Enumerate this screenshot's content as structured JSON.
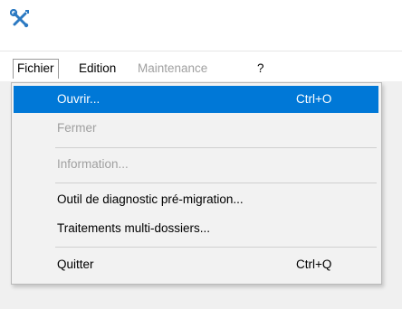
{
  "titlebar": {
    "icon": "tools-icon",
    "icon_color": "#2b79c2"
  },
  "menubar": {
    "items": [
      {
        "label": "Fichier",
        "state": "active"
      },
      {
        "label": "Edition",
        "state": "enabled"
      },
      {
        "label": "Maintenance",
        "state": "disabled"
      },
      {
        "label": "?",
        "state": "enabled"
      }
    ]
  },
  "file_menu": {
    "items": [
      {
        "label": "Ouvrir...",
        "shortcut": "Ctrl+O",
        "state": "highlighted"
      },
      {
        "label": "Fermer",
        "shortcut": "",
        "state": "disabled"
      },
      {
        "label": "Information...",
        "shortcut": "",
        "state": "disabled"
      },
      {
        "label": "Outil de diagnostic pré-migration...",
        "shortcut": "",
        "state": "enabled"
      },
      {
        "label": "Traitements multi-dossiers...",
        "shortcut": "",
        "state": "enabled"
      },
      {
        "label": "Quitter",
        "shortcut": "Ctrl+Q",
        "state": "enabled"
      }
    ]
  },
  "colors": {
    "highlight": "#0078d7",
    "disabled_text": "#a0a0a0",
    "menu_background": "#f2f2f2",
    "window_background": "#f0f0f0"
  }
}
